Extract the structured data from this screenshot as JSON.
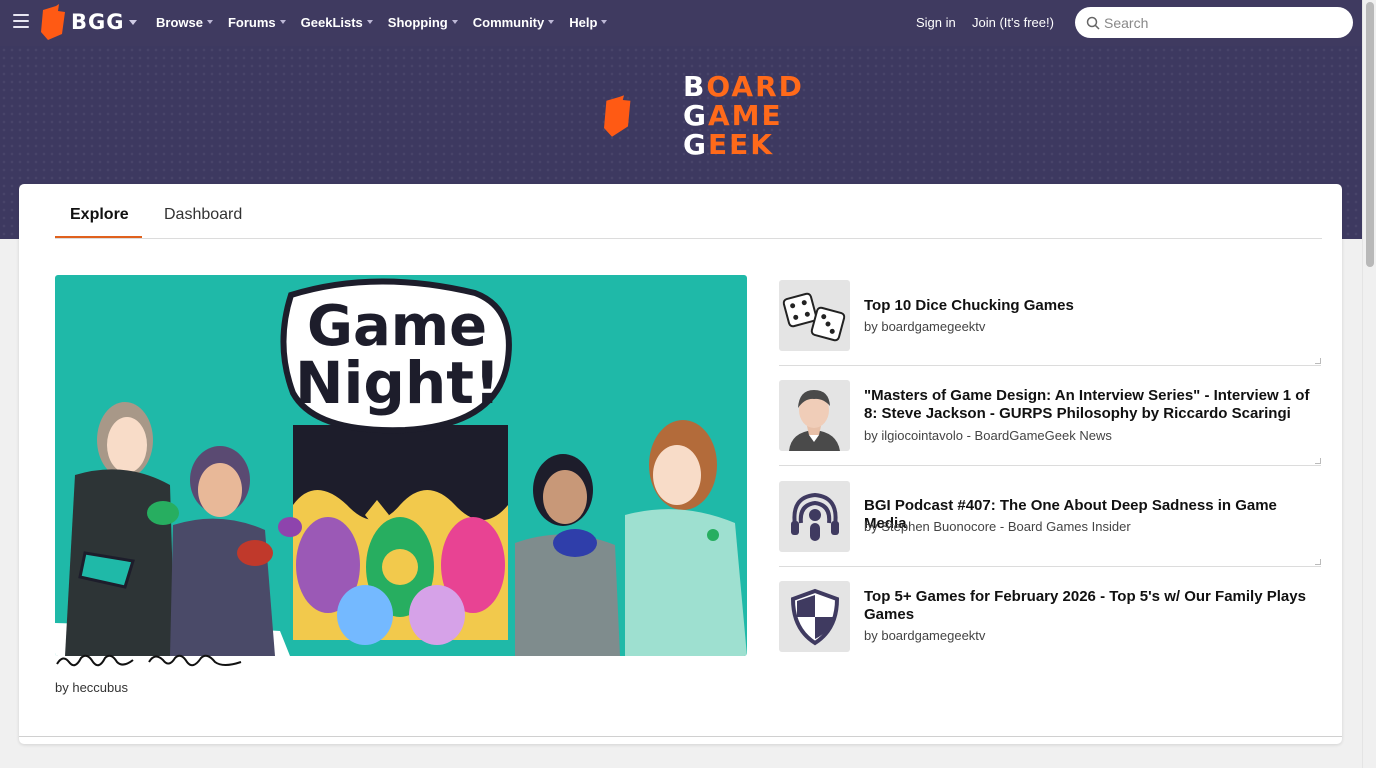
{
  "nav": {
    "brand": "BGG",
    "items": [
      {
        "label": "Browse"
      },
      {
        "label": "Forums"
      },
      {
        "label": "GeekLists"
      },
      {
        "label": "Shopping"
      },
      {
        "label": "Community"
      },
      {
        "label": "Help"
      }
    ],
    "sign_in": "Sign in",
    "join": "Join (It's free!)",
    "search_placeholder": "Search"
  },
  "hero": {
    "logo_lines": [
      {
        "first": "B",
        "rest": "OARD"
      },
      {
        "first": "G",
        "rest": "AME"
      },
      {
        "first": "G",
        "rest": "EEK"
      }
    ]
  },
  "tabs": [
    {
      "label": "Explore",
      "active": true
    },
    {
      "label": "Dashboard",
      "active": false
    }
  ],
  "feature": {
    "title_art": "Game Night!",
    "byline": "by heccubus"
  },
  "list": [
    {
      "title": "Top 10 Dice Chucking Games",
      "by": "by boardgamegeektv",
      "icon": "dice-icon"
    },
    {
      "title": "\"Masters of Game Design: An Interview Series\" - Interview 1 of 8: Steve Jackson - GURPS Philosophy by Riccardo Scaringi",
      "by": "by ilgiocointavolo - BoardGameGeek News",
      "icon": "person-avatar-icon"
    },
    {
      "title": "BGI Podcast #407: The One About Deep Sadness in Game Media",
      "by": "by Stephen Buonocore - Board Games Insider",
      "icon": "podcast-icon"
    },
    {
      "title": "Top 5+ Games for February 2026 - Top 5's w/ Our Family Plays Games",
      "by": "by boardgamegeektv",
      "icon": "shield-icon"
    }
  ],
  "colors": {
    "nav_bg": "#3f3a60",
    "brand_orange": "#ff6a1a",
    "tab_accent": "#e0611d",
    "feature_bg": "#1fb9a8"
  }
}
